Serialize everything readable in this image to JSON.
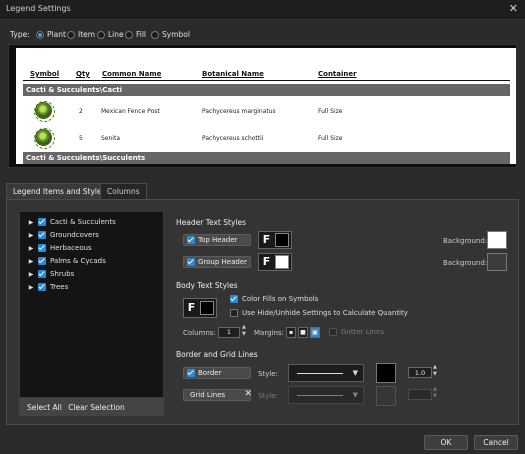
{
  "window": {
    "title": "Legend Settings",
    "close_glyph": "✕"
  },
  "type_row": {
    "label": "Type:",
    "options": [
      "Plant",
      "Item",
      "Line",
      "Fill",
      "Symbol"
    ],
    "selected": "Plant"
  },
  "preview": {
    "headers": [
      "Symbol",
      "Qty",
      "Common Name",
      "Botanical Name",
      "Container"
    ],
    "groups": [
      {
        "name": "Cacti & Succulents\\Cacti",
        "rows": [
          {
            "qty": "2",
            "common": "Mexican Fence Post",
            "botanical": "Pachycereus marginatus",
            "container": "Full Size"
          },
          {
            "qty": "5",
            "common": "Senita",
            "botanical": "Pachycereus schottii",
            "container": "Full Size"
          }
        ]
      },
      {
        "name": "Cacti & Succulents\\Succulents",
        "rows": []
      }
    ]
  },
  "tabs": [
    {
      "label": "Legend Items and Styles",
      "active": true
    },
    {
      "label": "Columns",
      "active": false
    }
  ],
  "tree": {
    "items": [
      "Cacti & Succulents",
      "Groundcovers",
      "Herbaceous",
      "Palms & Cycads",
      "Shrubs",
      "Trees"
    ],
    "footer": {
      "select_all": "Select All",
      "clear_selection": "Clear Selection"
    }
  },
  "header_text_styles": {
    "title": "Header Text Styles",
    "top_header": "Top Header",
    "group_header": "Group Header",
    "background_label": "Background:",
    "f_glyph": "F"
  },
  "body_text_styles": {
    "title": "Body Text Styles",
    "color_fills": "Color Fills on Symbols",
    "hide_unhide": "Use Hide/Unhide Settings to Calculate Quantity",
    "columns_label": "Columns:",
    "columns_value": "1",
    "margins_label": "Margins:",
    "gutter_lines": "Gutter Lines"
  },
  "border_grid": {
    "title": "Border and Grid Lines",
    "border": "Border",
    "grid_lines": "Grid Lines",
    "style_label": "Style:",
    "line_weight": "1.0"
  },
  "buttons": {
    "ok": "OK",
    "cancel": "Cancel"
  },
  "colors": {
    "accent": "#2a8ad8",
    "dark": "#2b2b2b"
  }
}
